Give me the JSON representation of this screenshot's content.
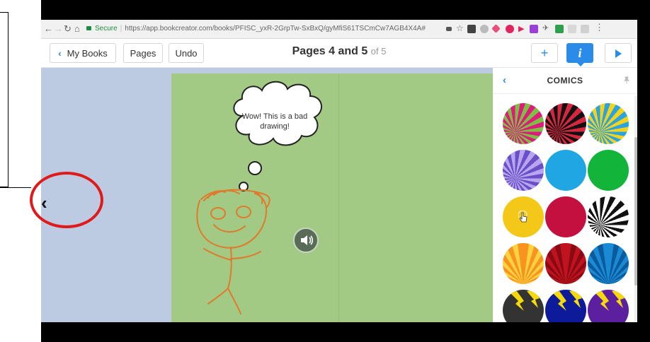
{
  "browser": {
    "secure_label": "Secure",
    "url": "https://app.bookcreator.com/books/PFISC_yxR-2GrpTw-SxBxQ/gyMfiS61TSCmCw7AGB4X4A#",
    "nav_icons": [
      "back-arrow-icon",
      "forward-arrow-icon",
      "reload-icon",
      "home-icon"
    ]
  },
  "toolbar": {
    "my_books_label": "My Books",
    "pages_label": "Pages",
    "undo_label": "Undo",
    "title": "Pages 4 and 5",
    "title_suffix": "of 5",
    "add_label": "+",
    "info_label": "i",
    "accent_color": "#2b8be9"
  },
  "page": {
    "speech_text": "Wow! This is a bad drawing!",
    "drawing_color": "#e07a2c",
    "page_color": "#a3ca84",
    "background_color": "#bccbe1"
  },
  "panel": {
    "title": "COMICS",
    "swatches": [
      {
        "name": "burst-green-pink",
        "colors": [
          "#7ac143",
          "#e2197c"
        ]
      },
      {
        "name": "burst-red-black",
        "colors": [
          "#d7263d",
          "#111111"
        ]
      },
      {
        "name": "burst-yellow-blue",
        "colors": [
          "#f7d21b",
          "#2aa4e0"
        ]
      },
      {
        "name": "burst-purple",
        "colors": [
          "#6a4fc8",
          "#b7a5f0"
        ]
      },
      {
        "name": "solid-cyan",
        "colors": [
          "#1fa6e3",
          "#1fa6e3"
        ]
      },
      {
        "name": "solid-green",
        "colors": [
          "#12b53a",
          "#12b53a"
        ]
      },
      {
        "name": "solid-yellow",
        "colors": [
          "#f4c818",
          "#f4c818"
        ]
      },
      {
        "name": "solid-crimson",
        "colors": [
          "#c4103f",
          "#c4103f"
        ]
      },
      {
        "name": "burst-black-white",
        "colors": [
          "#111111",
          "#ffffff"
        ]
      },
      {
        "name": "rays-orange",
        "colors": [
          "#f7931e",
          "#ffd23f"
        ]
      },
      {
        "name": "rays-red",
        "colors": [
          "#c1121f",
          "#8a0a13"
        ]
      },
      {
        "name": "rays-blue",
        "colors": [
          "#1a8ad4",
          "#0a5a9c"
        ]
      },
      {
        "name": "lightning-dark",
        "colors": [
          "#333333",
          "#f5d90a"
        ]
      },
      {
        "name": "lightning-navy",
        "colors": [
          "#0d1a9a",
          "#f5d90a"
        ]
      },
      {
        "name": "lightning-purple",
        "colors": [
          "#5b1fa0",
          "#f5d90a"
        ]
      }
    ]
  },
  "annotation": {
    "highlight_color": "#e01a1a"
  }
}
